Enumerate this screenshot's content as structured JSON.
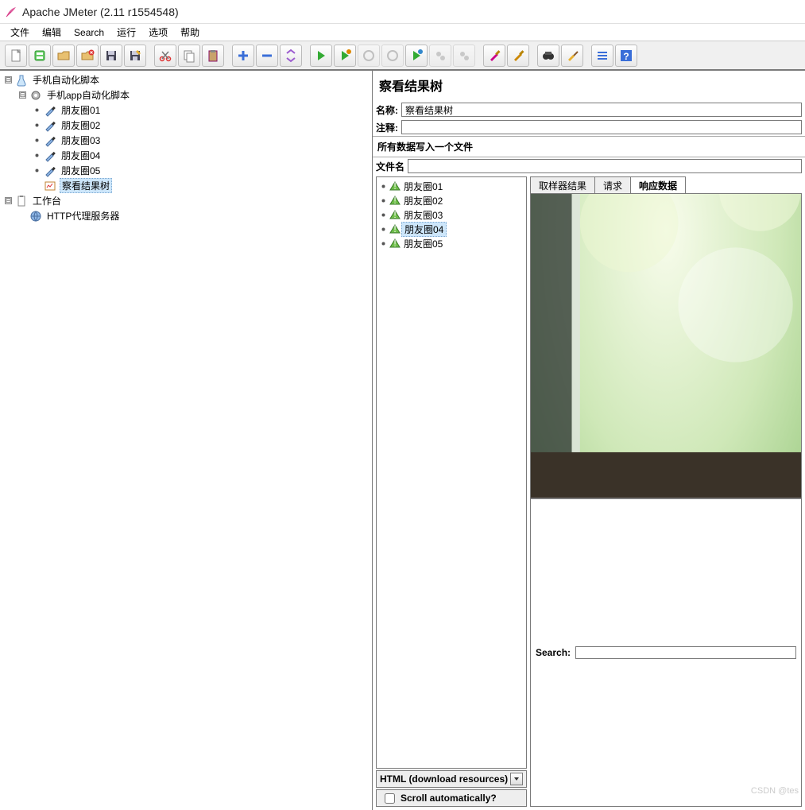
{
  "window": {
    "title": "Apache JMeter (2.11 r1554548)"
  },
  "menu": {
    "items": [
      "文件",
      "编辑",
      "Search",
      "运行",
      "选项",
      "帮助"
    ]
  },
  "toolbar": {
    "buttons": [
      {
        "name": "new-icon",
        "fill": "#fff",
        "stroke": "#888"
      },
      {
        "name": "templates-icon",
        "fill": "#6c6",
        "stroke": "#393"
      },
      {
        "name": "open-icon",
        "fill": "#e8c070",
        "stroke": "#b08030"
      },
      {
        "name": "close-icon",
        "fill": "#e8c070",
        "stroke": "#b08030",
        "badge": "#d33"
      },
      {
        "name": "save-icon",
        "fill": "#445",
        "stroke": "#223"
      },
      {
        "name": "save-as-icon",
        "fill": "#445",
        "stroke": "#223",
        "pencil": true
      },
      {
        "sep": true
      },
      {
        "name": "cut-icon",
        "stroke": "#d33"
      },
      {
        "name": "copy-icon",
        "fill": "#fff",
        "stroke": "#888"
      },
      {
        "name": "paste-icon",
        "fill": "#c9a26b",
        "stroke": "#816"
      },
      {
        "sep": true
      },
      {
        "name": "expand-icon",
        "stroke": "#3a6ed8",
        "plus": true
      },
      {
        "name": "collapse-icon",
        "stroke": "#3a6ed8",
        "minus": true
      },
      {
        "name": "toggle-icon",
        "stroke": "#9b5bcf"
      },
      {
        "sep": true
      },
      {
        "name": "start-icon",
        "fill": "#3a3",
        "play": true
      },
      {
        "name": "start-remote-icon",
        "fill": "#3a3",
        "play": true,
        "dot": "#d80"
      },
      {
        "name": "stop-icon",
        "disabled": true,
        "circle": "#888"
      },
      {
        "name": "shutdown-icon",
        "disabled": true,
        "circle": "#888"
      },
      {
        "name": "start-no-pause-icon",
        "fill": "#3a3",
        "play": true,
        "dot": "#38c"
      },
      {
        "name": "remote-start-all-icon",
        "disabled": true,
        "gears": true
      },
      {
        "name": "remote-stop-all-icon",
        "disabled": true,
        "gears": true
      },
      {
        "sep": true
      },
      {
        "name": "clear-icon",
        "brush": "#c08"
      },
      {
        "name": "clear-all-icon",
        "brush": "#c80"
      },
      {
        "sep": true
      },
      {
        "name": "search-icon",
        "binoc": true
      },
      {
        "name": "reset-search-icon",
        "broom": true
      },
      {
        "sep": true
      },
      {
        "name": "function-helper-icon",
        "list": true
      },
      {
        "name": "help-icon",
        "help": true
      }
    ]
  },
  "tree": {
    "nodes": [
      {
        "depth": 1,
        "handle": "open",
        "icon": "flask",
        "label": "手机自动化脚本"
      },
      {
        "depth": 2,
        "handle": "open",
        "icon": "gear",
        "label": "手机app自动化脚本"
      },
      {
        "depth": 3,
        "handle": "leaf-o",
        "icon": "dropper",
        "label": "朋友圈01"
      },
      {
        "depth": 3,
        "handle": "leaf-o",
        "icon": "dropper",
        "label": "朋友圈02"
      },
      {
        "depth": 3,
        "handle": "leaf-o",
        "icon": "dropper",
        "label": "朋友圈03"
      },
      {
        "depth": 3,
        "handle": "leaf-o",
        "icon": "dropper",
        "label": "朋友圈04"
      },
      {
        "depth": 3,
        "handle": "leaf-o",
        "icon": "dropper",
        "label": "朋友圈05"
      },
      {
        "depth": 3,
        "handle": "leaf",
        "icon": "results",
        "label": "察看结果树",
        "selected": true
      },
      {
        "depth": 1,
        "handle": "open",
        "icon": "clipboard",
        "label": "工作台"
      },
      {
        "depth": 2,
        "handle": "leaf",
        "icon": "proxy",
        "label": "HTTP代理服务器"
      }
    ]
  },
  "panel": {
    "title": "察看结果树",
    "name_label": "名称:",
    "name_value": "察看结果树",
    "comment_label": "注释:",
    "comment_value": "",
    "write_section": "所有数据写入一个文件",
    "filename_label": "文件名"
  },
  "results": {
    "items": [
      {
        "label": "朋友圈01"
      },
      {
        "label": "朋友圈02"
      },
      {
        "label": "朋友圈03"
      },
      {
        "label": "朋友圈04",
        "selected": true
      },
      {
        "label": "朋友圈05"
      }
    ],
    "tabs": [
      "取样器结果",
      "请求",
      "响应数据"
    ],
    "active_tab": 2,
    "dropdown": "HTML (download resources)",
    "scroll_check": "Scroll automatically?",
    "search_label": "Search:"
  },
  "watermark": "CSDN @tes"
}
